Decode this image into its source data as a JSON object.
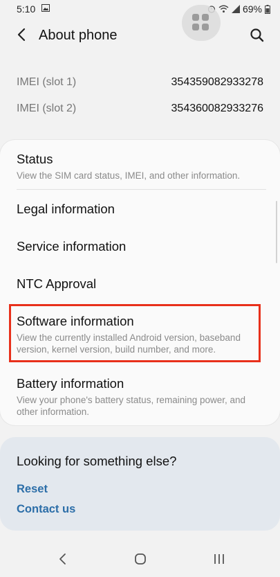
{
  "status_bar": {
    "time": "5:10",
    "battery": "69%"
  },
  "header": {
    "title": "About phone"
  },
  "imei": [
    {
      "label": "IMEI (slot 1)",
      "value": "354359082933278"
    },
    {
      "label": "IMEI (slot 2)",
      "value": "354360082933276"
    }
  ],
  "menu": {
    "items": [
      {
        "title": "Status",
        "desc": "View the SIM card status, IMEI, and other information."
      },
      {
        "title": "Legal information",
        "desc": ""
      },
      {
        "title": "Service information",
        "desc": ""
      },
      {
        "title": "NTC Approval",
        "desc": ""
      },
      {
        "title": "Software information",
        "desc": "View the currently installed Android version, baseband version, kernel version, build number, and more."
      },
      {
        "title": "Battery information",
        "desc": "View your phone's battery status, remaining power, and other information."
      }
    ]
  },
  "suggestions": {
    "title": "Looking for something else?",
    "links": [
      "Reset",
      "Contact us"
    ]
  },
  "colors": {
    "highlight": "#e8301b",
    "link": "#2c6ea8"
  }
}
